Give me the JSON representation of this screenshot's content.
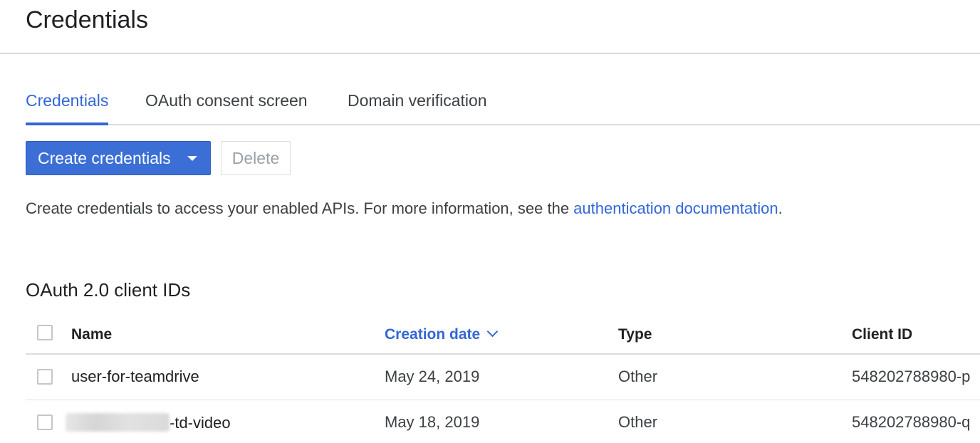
{
  "header": {
    "title": "Credentials"
  },
  "tabs": [
    {
      "label": "Credentials",
      "active": true
    },
    {
      "label": "OAuth consent screen",
      "active": false
    },
    {
      "label": "Domain verification",
      "active": false
    }
  ],
  "toolbar": {
    "create_label": "Create credentials",
    "delete_label": "Delete"
  },
  "info": {
    "text": "Create credentials to access your enabled APIs. For more information, see the ",
    "link": "authentication documentation",
    "suffix": "."
  },
  "section": {
    "title": "OAuth 2.0 client IDs"
  },
  "table": {
    "columns": [
      "Name",
      "Creation date",
      "Type",
      "Client ID"
    ],
    "rows": [
      {
        "name": "user-for-teamdrive",
        "date": "May 24, 2019",
        "type": "Other",
        "client_id": "548202788980-p"
      },
      {
        "name": "-td-video",
        "date": "May 18, 2019",
        "type": "Other",
        "client_id": "548202788980-q"
      }
    ]
  },
  "colors": {
    "accent": "#3367d6",
    "primary_button": "#3b6fd6"
  },
  "icons": {
    "dropdown": "caret-down-icon",
    "sort": "chevron-down-icon"
  }
}
